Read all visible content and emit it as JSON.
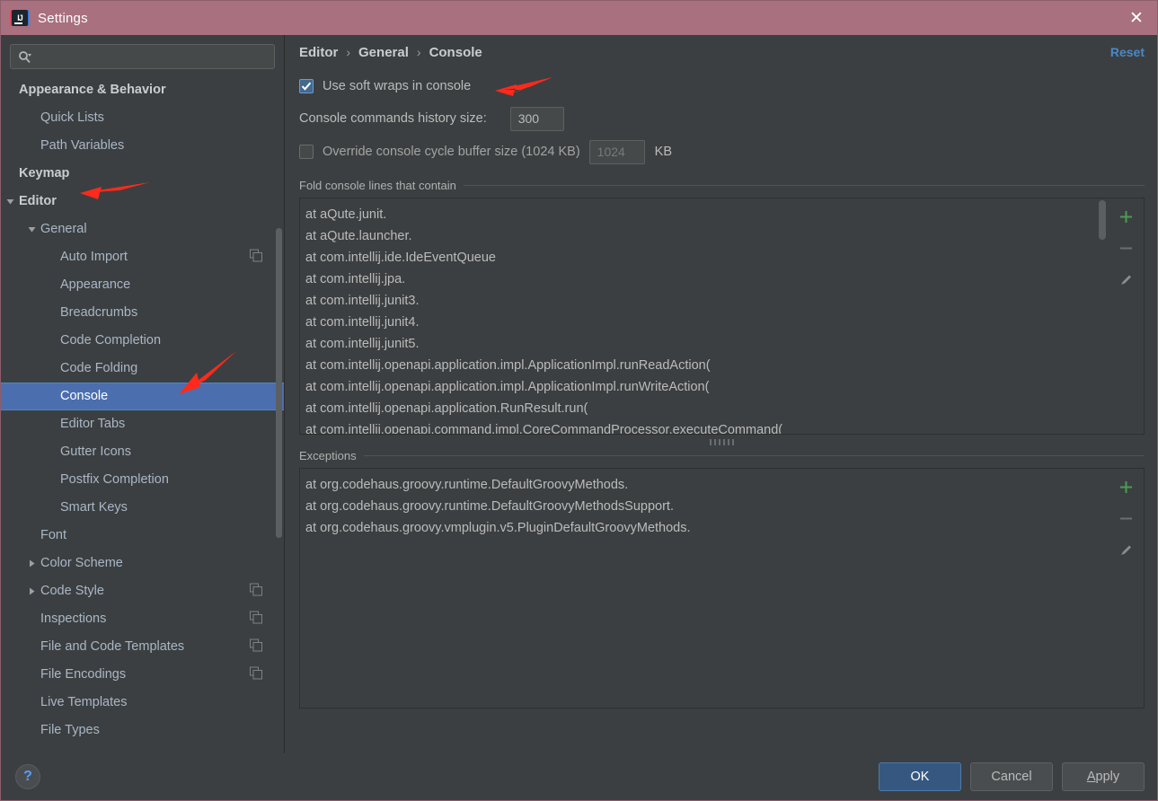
{
  "window": {
    "title": "Settings",
    "logo_icon": "intellij-idea-logo",
    "close_icon": "close-icon",
    "titlebar_color": "#a9707f"
  },
  "sidebar": {
    "search": {
      "placeholder": "",
      "value": "",
      "icon": "search-icon",
      "dropdown_icon": "chevron-down-icon"
    },
    "items": [
      {
        "label": "Appearance & Behavior",
        "depth": 0,
        "bold": true,
        "arrow": "none",
        "selected": false,
        "copy_icon": false
      },
      {
        "label": "Quick Lists",
        "depth": 1,
        "bold": false,
        "arrow": "none",
        "selected": false,
        "copy_icon": false
      },
      {
        "label": "Path Variables",
        "depth": 1,
        "bold": false,
        "arrow": "none",
        "selected": false,
        "copy_icon": false
      },
      {
        "label": "Keymap",
        "depth": 0,
        "bold": true,
        "arrow": "none",
        "selected": false,
        "copy_icon": false
      },
      {
        "label": "Editor",
        "depth": 0,
        "bold": true,
        "arrow": "down",
        "selected": false,
        "copy_icon": false
      },
      {
        "label": "General",
        "depth": 1,
        "bold": false,
        "arrow": "down",
        "selected": false,
        "copy_icon": false
      },
      {
        "label": "Auto Import",
        "depth": 2,
        "bold": false,
        "arrow": "none",
        "selected": false,
        "copy_icon": true
      },
      {
        "label": "Appearance",
        "depth": 2,
        "bold": false,
        "arrow": "none",
        "selected": false,
        "copy_icon": false
      },
      {
        "label": "Breadcrumbs",
        "depth": 2,
        "bold": false,
        "arrow": "none",
        "selected": false,
        "copy_icon": false
      },
      {
        "label": "Code Completion",
        "depth": 2,
        "bold": false,
        "arrow": "none",
        "selected": false,
        "copy_icon": false
      },
      {
        "label": "Code Folding",
        "depth": 2,
        "bold": false,
        "arrow": "none",
        "selected": false,
        "copy_icon": false
      },
      {
        "label": "Console",
        "depth": 2,
        "bold": false,
        "arrow": "none",
        "selected": true,
        "copy_icon": false
      },
      {
        "label": "Editor Tabs",
        "depth": 2,
        "bold": false,
        "arrow": "none",
        "selected": false,
        "copy_icon": false
      },
      {
        "label": "Gutter Icons",
        "depth": 2,
        "bold": false,
        "arrow": "none",
        "selected": false,
        "copy_icon": false
      },
      {
        "label": "Postfix Completion",
        "depth": 2,
        "bold": false,
        "arrow": "none",
        "selected": false,
        "copy_icon": false
      },
      {
        "label": "Smart Keys",
        "depth": 2,
        "bold": false,
        "arrow": "none",
        "selected": false,
        "copy_icon": false
      },
      {
        "label": "Font",
        "depth": 1,
        "bold": false,
        "arrow": "none",
        "selected": false,
        "copy_icon": false
      },
      {
        "label": "Color Scheme",
        "depth": 1,
        "bold": false,
        "arrow": "right",
        "selected": false,
        "copy_icon": false
      },
      {
        "label": "Code Style",
        "depth": 1,
        "bold": false,
        "arrow": "right",
        "selected": false,
        "copy_icon": true
      },
      {
        "label": "Inspections",
        "depth": 1,
        "bold": false,
        "arrow": "none",
        "selected": false,
        "copy_icon": true
      },
      {
        "label": "File and Code Templates",
        "depth": 1,
        "bold": false,
        "arrow": "none",
        "selected": false,
        "copy_icon": true
      },
      {
        "label": "File Encodings",
        "depth": 1,
        "bold": false,
        "arrow": "none",
        "selected": false,
        "copy_icon": true
      },
      {
        "label": "Live Templates",
        "depth": 1,
        "bold": false,
        "arrow": "none",
        "selected": false,
        "copy_icon": false
      },
      {
        "label": "File Types",
        "depth": 1,
        "bold": false,
        "arrow": "none",
        "selected": false,
        "copy_icon": false
      }
    ]
  },
  "content": {
    "breadcrumb": [
      "Editor",
      "General",
      "Console"
    ],
    "breadcrumb_separator": "›",
    "reset_label": "Reset",
    "soft_wraps": {
      "label": "Use soft wraps in console",
      "checked": true
    },
    "history_size": {
      "label": "Console commands history size:",
      "value": "300"
    },
    "cycle_buffer": {
      "label": "Override console cycle buffer size (1024 KB)",
      "checked": false,
      "value": "1024",
      "unit": "KB"
    },
    "fold_group": {
      "title": "Fold console lines that contain",
      "lines": [
        "at aQute.junit.",
        "at aQute.launcher.",
        "at com.intellij.ide.IdeEventQueue",
        "at com.intellij.jpa.",
        "at com.intellij.junit3.",
        "at com.intellij.junit4.",
        "at com.intellij.junit5.",
        "at com.intellij.openapi.application.impl.ApplicationImpl.runReadAction(",
        "at com.intellij.openapi.application.impl.ApplicationImpl.runWriteAction(",
        "at com.intellij.openapi.application.RunResult.run(",
        "at com.intellij.openapi.command.impl.CoreCommandProcessor.executeCommand("
      ],
      "add_icon": "plus-icon",
      "remove_icon": "minus-icon",
      "edit_icon": "pencil-icon"
    },
    "exceptions_group": {
      "title": "Exceptions",
      "lines": [
        "at org.codehaus.groovy.runtime.DefaultGroovyMethods.",
        "at org.codehaus.groovy.runtime.DefaultGroovyMethodsSupport.",
        "at org.codehaus.groovy.vmplugin.v5.PluginDefaultGroovyMethods."
      ],
      "add_icon": "plus-icon",
      "remove_icon": "minus-icon",
      "edit_icon": "pencil-icon"
    }
  },
  "footer": {
    "help_icon": "help-question-icon",
    "ok_label": "OK",
    "cancel_label": "Cancel",
    "apply_label_mnemonic": "A",
    "apply_label_rest": "pply"
  },
  "colors": {
    "accent_selection": "#4b6eaf",
    "link": "#4a88c7",
    "primary_button": "#365880",
    "panel_bg": "#3c3f41",
    "add_icon_green": "#499c54",
    "annotation_arrow": "#ff2a1c"
  }
}
